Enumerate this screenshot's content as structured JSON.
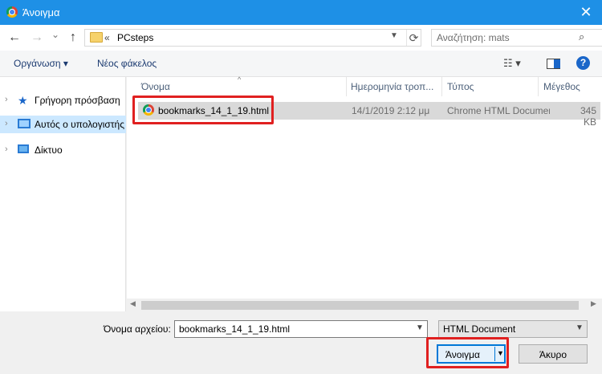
{
  "window": {
    "title": "Άνοιγμα",
    "close_glyph": "✕",
    "icon": "chrome-icon"
  },
  "nav": {
    "back": "←",
    "forward": "→",
    "recent": "⌄",
    "up": "↑"
  },
  "address": {
    "separator": "«",
    "crumb": "PCsteps",
    "refresh": "⟳"
  },
  "search": {
    "placeholder": "Αναζήτηση: mats"
  },
  "toolbar": {
    "organize": "Οργάνωση ▾",
    "new_folder": "Νέος φάκελος",
    "help": "?"
  },
  "sidebar": {
    "items": [
      {
        "label": "Γρήγορη πρόσβαση",
        "icon": "star-icon"
      },
      {
        "label": "Αυτός ο υπολογιστής",
        "icon": "computer-icon",
        "selected": true
      },
      {
        "label": "Δίκτυο",
        "icon": "network-icon"
      }
    ]
  },
  "columns": {
    "name": "Όνομα",
    "date": "Ημερομηνία τροπ...",
    "type": "Τύπος",
    "size": "Μέγεθος"
  },
  "files": [
    {
      "name": "bookmarks_14_1_19.html",
      "date": "14/1/2019 2:12 μμ",
      "type": "Chrome HTML Document",
      "size": "345 KB",
      "icon": "chrome-icon"
    }
  ],
  "filename": {
    "label": "Όνομα αρχείου:",
    "value": "bookmarks_14_1_19.html"
  },
  "filetype": {
    "value": "HTML Document"
  },
  "buttons": {
    "open": "Άνοιγμα",
    "cancel": "Άκυρο"
  },
  "colors": {
    "titlebar": "#1e90e6",
    "highlight": "#e02020",
    "selection": "#cce8ff"
  }
}
